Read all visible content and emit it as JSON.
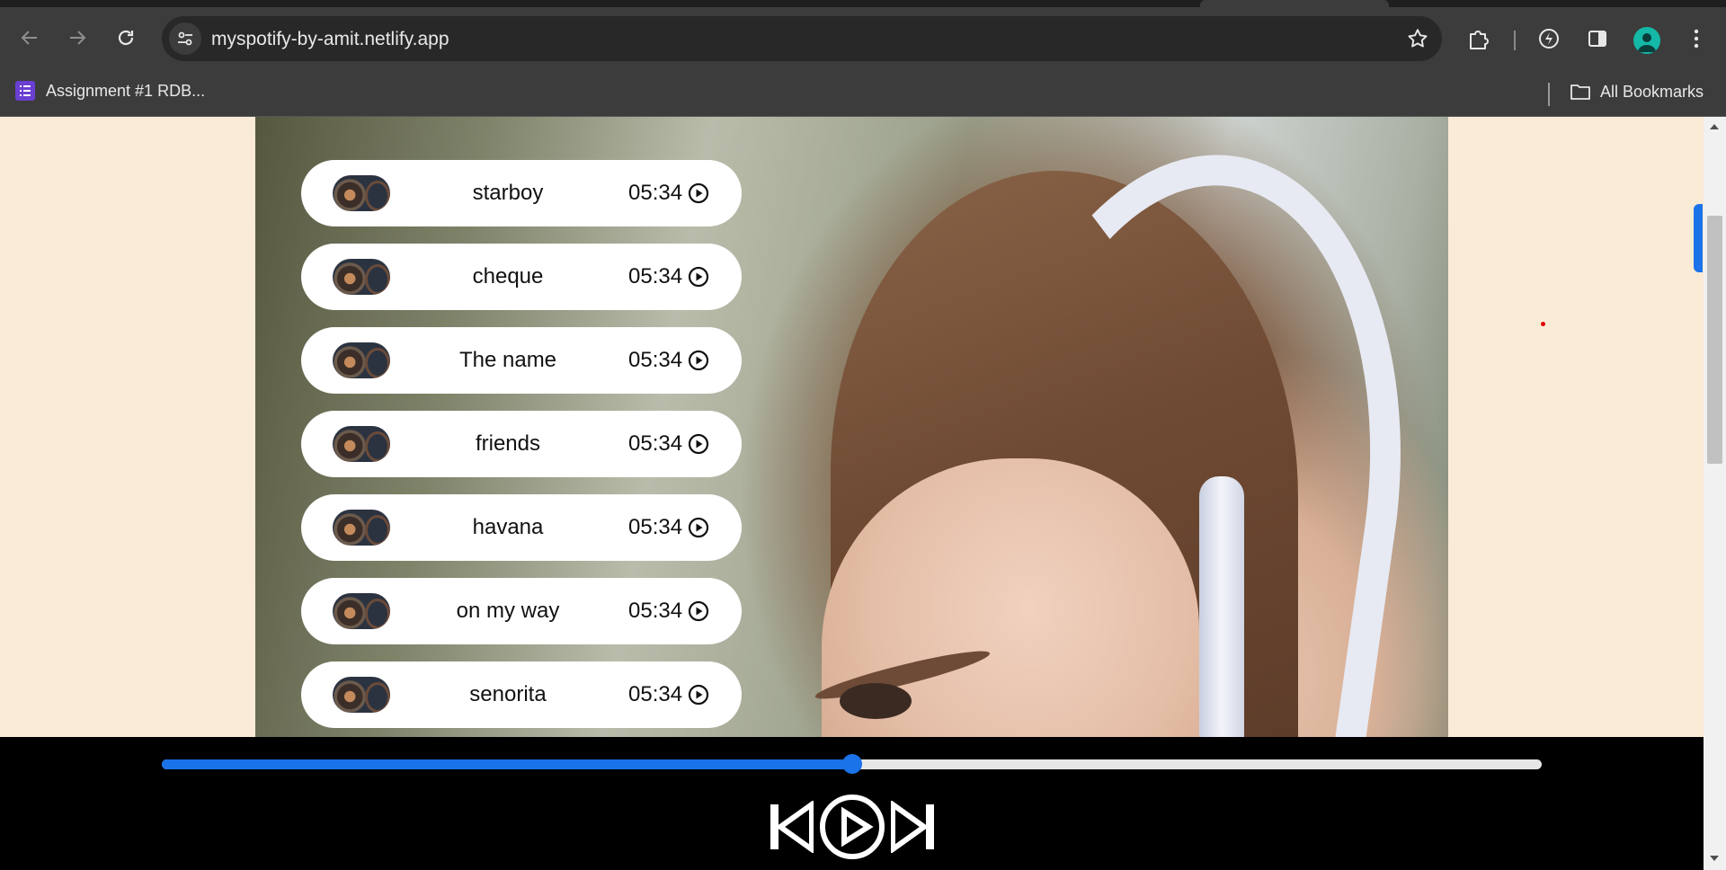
{
  "browser": {
    "url": "myspotify-by-amit.netlify.app",
    "bookmark_label": "Assignment #1 RDB...",
    "all_bookmarks_label": "All Bookmarks"
  },
  "songs": [
    {
      "name": "starboy",
      "duration": "05:34"
    },
    {
      "name": "cheque",
      "duration": "05:34"
    },
    {
      "name": "The name",
      "duration": "05:34"
    },
    {
      "name": "friends",
      "duration": "05:34"
    },
    {
      "name": "havana",
      "duration": "05:34"
    },
    {
      "name": "on my way",
      "duration": "05:34"
    },
    {
      "name": "senorita",
      "duration": "05:34"
    }
  ],
  "player": {
    "progress_fraction": 0.5,
    "accent_color": "#1a73e8"
  },
  "icons": {
    "back": "back-arrow-icon",
    "forward": "forward-arrow-icon",
    "reload": "reload-icon",
    "previous": "previous-track-icon",
    "play": "play-circle-icon",
    "next": "next-track-icon"
  },
  "colors": {
    "page_background": "#faebd7",
    "song_card": "#ffffff",
    "player_background": "#000000"
  }
}
